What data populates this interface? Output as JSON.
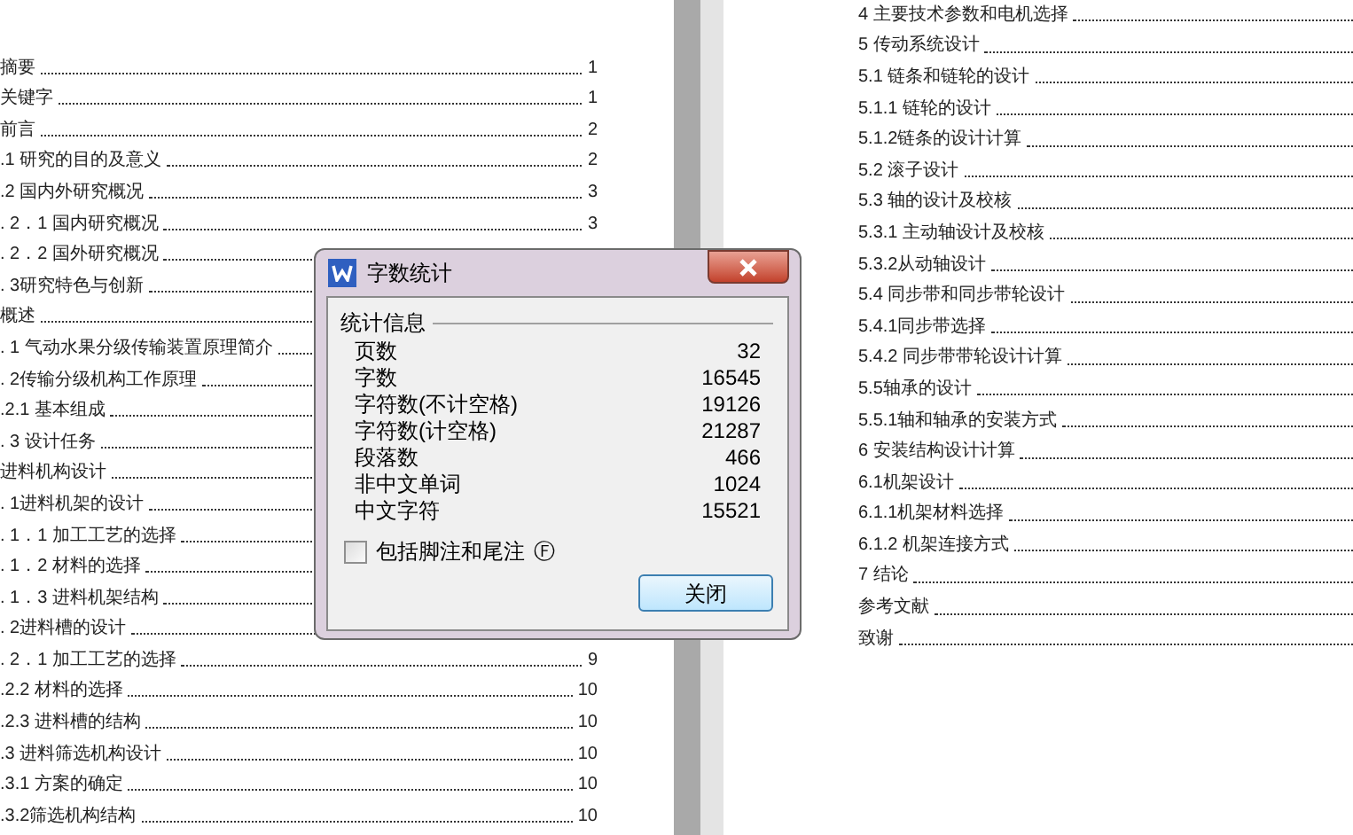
{
  "left_page": {
    "entries": [
      {
        "text": "摘要",
        "page": "1"
      },
      {
        "text": "关键字",
        "page": "1"
      },
      {
        "text": "前言",
        "page": "2"
      },
      {
        "text": ".1 研究的目的及意义",
        "page": "2"
      },
      {
        "text": ".2 国内外研究概况",
        "page": "3"
      },
      {
        "text": ". 2．1 国内研究概况",
        "page": "3"
      },
      {
        "text": ". 2．2 国外研究概况"
      },
      {
        "text": ". 3研究特色与创新"
      },
      {
        "text": "概述"
      },
      {
        "text": ". 1 气动水果分级传输装置原理简介"
      },
      {
        "text": ". 2传输分级机构工作原理"
      },
      {
        "text": ".2.1 基本组成"
      },
      {
        "text": ". 3 设计任务"
      },
      {
        "text": "进料机构设计"
      },
      {
        "text": ". 1进料机架的设计"
      },
      {
        "text": ". 1．1 加工工艺的选择"
      },
      {
        "text": ". 1．2 材料的选择"
      },
      {
        "text": ". 1．3 进料机架结构"
      },
      {
        "text": ". 2进料槽的设计"
      },
      {
        "text": ". 2．1 加工工艺的选择",
        "page": "9"
      },
      {
        "text": ".2.2 材料的选择",
        "page": "10"
      },
      {
        "text": ".2.3 进料槽的结构",
        "page": "10"
      },
      {
        "text": ".3 进料筛选机构设计",
        "page": "10"
      },
      {
        "text": ".3.1 方案的确定",
        "page": "10"
      },
      {
        "text": ".3.2筛选机构结构",
        "page": "10"
      }
    ]
  },
  "right_page": {
    "entries": [
      {
        "text": "4 主要技术参数和电机选择"
      },
      {
        "text": "5 传动系统设计"
      },
      {
        "text": "5.1 链条和链轮的设计"
      },
      {
        "text": "5.1.1 链轮的设计"
      },
      {
        "text": "5.1.2链条的设计计算"
      },
      {
        "text": "5.2 滚子设计"
      },
      {
        "text": "5.3 轴的设计及校核"
      },
      {
        "text": "5.3.1 主动轴设计及校核"
      },
      {
        "text": "5.3.2从动轴设计"
      },
      {
        "text": "5.4 同步带和同步带轮设计"
      },
      {
        "text": "5.4.1同步带选择"
      },
      {
        "text": "5.4.2 同步带带轮设计计算"
      },
      {
        "text": "5.5轴承的设计"
      },
      {
        "text": "5.5.1轴和轴承的安装方式"
      },
      {
        "text": "6 安装结构设计计算"
      },
      {
        "text": "6.1机架设计"
      },
      {
        "text": "6.1.1机架材料选择"
      },
      {
        "text": "6.1.2 机架连接方式"
      },
      {
        "text": "7 结论"
      },
      {
        "text": "参考文献"
      },
      {
        "text": "致谢"
      }
    ]
  },
  "dialog": {
    "title": "字数统计",
    "group_label": "统计信息",
    "stats": [
      {
        "label": "页数",
        "value": "32"
      },
      {
        "label": "字数",
        "value": "16545"
      },
      {
        "label": "字符数(不计空格)",
        "value": "19126"
      },
      {
        "label": "字符数(计空格)",
        "value": "21287"
      },
      {
        "label": "段落数",
        "value": "466"
      },
      {
        "label": "非中文单词",
        "value": "1024"
      },
      {
        "label": "中文字符",
        "value": "15521"
      }
    ],
    "checkbox": {
      "label": "包括脚注和尾注",
      "shortcut": "Ⓕ",
      "checked": false
    },
    "button": "关闭"
  }
}
